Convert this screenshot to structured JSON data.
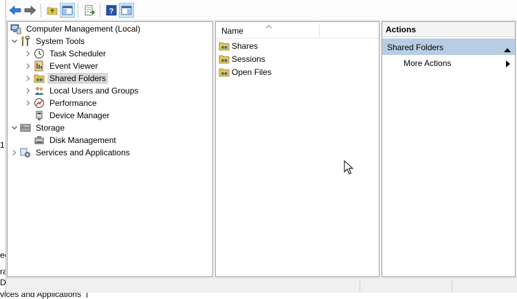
{
  "background": {
    "fragments": [
      "1",
      "ed",
      "ra",
      "D"
    ],
    "bottom_text": "vices and Applications"
  },
  "toolbar": {
    "icons": [
      "back-icon",
      "forward-icon",
      "up-folder-icon",
      "show-hide-console-tree-icon",
      "export-list-icon",
      "help-icon",
      "show-hide-action-pane-icon"
    ]
  },
  "tree": {
    "items": [
      {
        "label": "Computer Management (Local)",
        "icon": "computer-management-icon",
        "level": 0,
        "expander": "none"
      },
      {
        "label": "System Tools",
        "icon": "system-tools-icon",
        "level": 1,
        "expander": "expanded"
      },
      {
        "label": "Task Scheduler",
        "icon": "clock-icon",
        "level": 2,
        "expander": "collapsed"
      },
      {
        "label": "Event Viewer",
        "icon": "event-viewer-icon",
        "level": 2,
        "expander": "collapsed"
      },
      {
        "label": "Shared Folders",
        "icon": "shared-folder-icon",
        "level": 2,
        "expander": "collapsed",
        "selected": true
      },
      {
        "label": "Local Users and Groups",
        "icon": "users-icon",
        "level": 2,
        "expander": "collapsed"
      },
      {
        "label": "Performance",
        "icon": "performance-icon",
        "level": 2,
        "expander": "collapsed"
      },
      {
        "label": "Device Manager",
        "icon": "device-manager-icon",
        "level": 2,
        "expander": "none"
      },
      {
        "label": "Storage",
        "icon": "storage-icon",
        "level": 1,
        "expander": "expanded"
      },
      {
        "label": "Disk Management",
        "icon": "disk-icon",
        "level": 2,
        "expander": "none"
      },
      {
        "label": "Services and Applications",
        "icon": "services-icon",
        "level": 1,
        "expander": "collapsed"
      }
    ]
  },
  "list": {
    "column_name": "Name",
    "items": [
      {
        "label": "Shares",
        "icon": "shared-folder-icon"
      },
      {
        "label": "Sessions",
        "icon": "shared-folder-icon"
      },
      {
        "label": "Open Files",
        "icon": "shared-folder-icon"
      }
    ]
  },
  "actions": {
    "header": "Actions",
    "section": "Shared Folders",
    "more_actions": "More Actions"
  },
  "colors": {
    "section_bg": "#b7cde3",
    "selected_bg": "#d9d9d9",
    "accent_blue": "#1e6fd9"
  }
}
